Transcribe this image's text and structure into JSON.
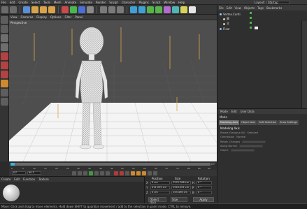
{
  "menubar": {
    "items": [
      "File",
      "Edit",
      "Create",
      "Select",
      "Tools",
      "Mesh",
      "Animate",
      "Simulate",
      "Render",
      "Sculpt",
      "Character",
      "Plugins",
      "Script",
      "Window",
      "Help"
    ]
  },
  "layout": {
    "label": "Layout:",
    "value": "Startup"
  },
  "viewport": {
    "menu": [
      "View",
      "Cameras",
      "Display",
      "Options",
      "Filter",
      "Panel"
    ],
    "label": "Perspective"
  },
  "timeline": {
    "ticks": [
      "0",
      "5",
      "10",
      "15",
      "20",
      "25",
      "30",
      "35",
      "40",
      "45",
      "50",
      "55",
      "60",
      "65",
      "70",
      "75",
      "80",
      "85",
      "90"
    ],
    "end_frame": "0 F"
  },
  "transport": {
    "start_field": "0 F",
    "end_field": "90 F"
  },
  "materials": {
    "menu": [
      "Create",
      "Edit",
      "Function",
      "Texture"
    ]
  },
  "coordinates": {
    "headers": [
      "Position",
      "Size",
      "Rotation"
    ],
    "rows": [
      {
        "axis": "X",
        "pos": "0 cm",
        "size": "1270.768 cm",
        "rot_label": "H",
        "rot": "0 °"
      },
      {
        "axis": "Y",
        "pos": "411.039 cm",
        "size": "1224.201 cm",
        "rot_label": "P",
        "rot": "0 °"
      },
      {
        "axis": "Z",
        "pos": "0 cm",
        "size": "153.496 cm",
        "rot_label": "B",
        "rot": "0 °"
      }
    ],
    "object_select": "Object (Rel)",
    "size_select": "Size",
    "apply_label": "Apply"
  },
  "object_manager": {
    "menu": [
      "File",
      "Edit",
      "View",
      "Objects",
      "Tags",
      "Bookmarks"
    ],
    "rows": [
      {
        "name": "Vertex.Conti",
        "color": "#a0c4ff"
      },
      {
        "name": "脚",
        "color": "#e1c7a8"
      },
      {
        "name": "主",
        "color": "#e1c7a8"
      },
      {
        "name": "Floor",
        "color": "#7cc2ff"
      }
    ]
  },
  "attributes": {
    "menu": [
      "Mode",
      "Edit",
      "User Data"
    ],
    "mode_label": "Mode",
    "tabs": [
      "Modeling Axis",
      "Object Axis",
      "Soft Selection",
      "Snap Settings"
    ],
    "section": "Modeling Axis",
    "props": [
      {
        "label": "Rotate Dialogue (N)",
        "value": "Selected"
      },
      {
        "label": "Orientation",
        "value": "Normal"
      },
      {
        "label": "Retain Changes",
        "value": ""
      },
      {
        "label": "Along Normal",
        "value": ""
      },
      {
        "label": "Object",
        "value": ""
      }
    ]
  },
  "statusbar": {
    "text": "Move: Click and drag to move elements. Hold down SHIFT to quantize movement / add to the selection in point mode, CTRL to remove."
  }
}
